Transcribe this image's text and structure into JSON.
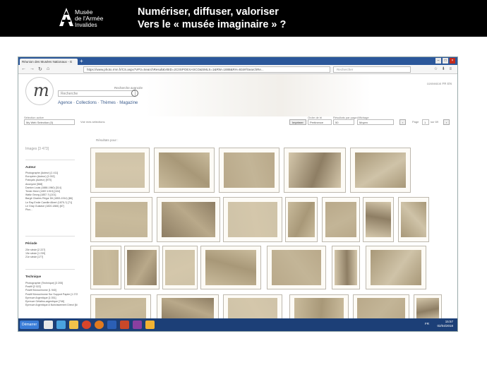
{
  "slide": {
    "logo_line1": "Musée",
    "logo_line2": "de l'Armée",
    "logo_line3": "Invalides",
    "title_line1": "Numériser, diffuser, valoriser",
    "title_line2": "Vers le « musée imaginaire » ?"
  },
  "browser": {
    "tab_title": "Réunion des Musées Nationaux - G",
    "url": "https://www.photo.rmn.fr/CS.aspx?VP3=SearchResult&VBID=2C0SPOEXASCO&SMLS=1&RW=1888&RH=934#/SearchRe...",
    "search_placeholder": "Rechercher"
  },
  "site": {
    "logo_glyph": "m",
    "advanced_search": "Recherche avancée",
    "search_placeholder": "Recherche",
    "nav": "Agence · Collections · Thèmes · Magazine",
    "top_right": "connexion  FR  EN"
  },
  "toolbar": {
    "selection_label": "Sélection active",
    "selection_value": "My Web Selection (0)",
    "see_selection": "Voir mes sélections",
    "print_button": "Imprimer",
    "order_label": "Ordre de tri",
    "order_value": "Pertinence",
    "per_page_label": "Résultats par page",
    "per_page_value": "50",
    "display_label": "Affichage",
    "display_value": "Moyen",
    "page_label": "Page",
    "page_value": "1",
    "page_total": "sur 69"
  },
  "sidebar": {
    "images_count": "Images [3 473]",
    "author_title": "Auteur",
    "authors": [
      "Photographe (Auteur) [1 411]",
      "Européen (Auteur) [1 002]",
      "Français (Auteur) [970]",
      "Anonyme [568]",
      "Danton Louis (1888-1960) [314]",
      "Tenier Henri (1857-1919) [104]",
      "Waltz Georg (1857-?) [101]",
      "Bargé Charles Régor Dit (1853-1914) [86]",
      "Le Ray Emile Camille Albert (1875-?) [71]",
      "Le Gray Gustave (1820-1884) [67]",
      "Plus..."
    ],
    "period_title": "Période",
    "periods": [
      "20e siècle [2 227]",
      "19e siècle [1 239]",
      "21e siècle [177]"
    ],
    "technique_title": "Technique",
    "techniques": [
      "Photographie (Technique) [3 205]",
      "Positif [2 022]",
      "Positif Monochrome [1 940]",
      "Positif Monochrome Sur Support Papier [1 272]",
      "Epreuve Argentique [1 051]",
      "Epreuve Gélatino-argentique [746]",
      "Epreuve Argentique A Noircissement Direct [642]"
    ]
  },
  "results": {
    "label": "Résultats pour :"
  },
  "taskbar": {
    "start": "Démarrer",
    "lang": "FR",
    "time": "15:57",
    "date": "02/04/2018"
  }
}
